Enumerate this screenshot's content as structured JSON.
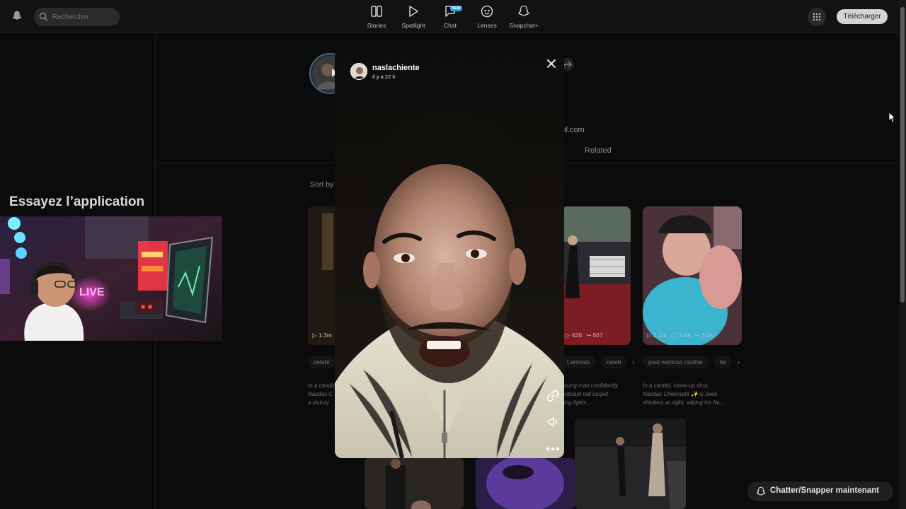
{
  "header": {
    "search_placeholder": "Rechercher",
    "nav": [
      {
        "label": "Stories",
        "icon": "stories-icon"
      },
      {
        "label": "Spotlight",
        "icon": "spotlight-play-icon"
      },
      {
        "label": "Chat",
        "icon": "chat-icon",
        "badge": "NEW"
      },
      {
        "label": "Lenses",
        "icon": "lenses-icon"
      },
      {
        "label": "Snapchat+",
        "icon": "snapchat-plus-icon"
      }
    ],
    "download_label": "Télécharger"
  },
  "left_panel": {
    "promo_title": "Essayez l’application"
  },
  "profile": {
    "email_fragment": "il.com",
    "related_tab": "Related",
    "sort_label": "Sort by"
  },
  "cards": [
    {
      "stats": [
        "1.3m"
      ]
    },
    {
      "stats": [
        "626",
        "567"
      ]
    },
    {
      "stats": [
        "2.1m",
        "1.9k",
        "3.2k"
      ]
    }
  ],
  "chips": {
    "left": [
      "celebr"
    ],
    "right": [
      "t arrivals",
      "celeb",
      "post workout routine",
      "he"
    ]
  },
  "descriptions": [
    "In a candid\nNasdas C\na victory",
    "oung man confidently\nvibrant red carpet\ning lights....",
    "In a candid, close-up shot,\nNasdas Chienneté ✨ is seen\nshirtless at night, wiping his fac..."
  ],
  "story": {
    "username": "naslachiente",
    "time_ago": "Il y a 22 h"
  },
  "chat_cta": "Chatter/Snapper maintenant",
  "colors": {
    "background": "#0b0b0b",
    "topbar": "#121212",
    "badge": "#2fa7e6",
    "download_button": "#d4d4d4"
  }
}
